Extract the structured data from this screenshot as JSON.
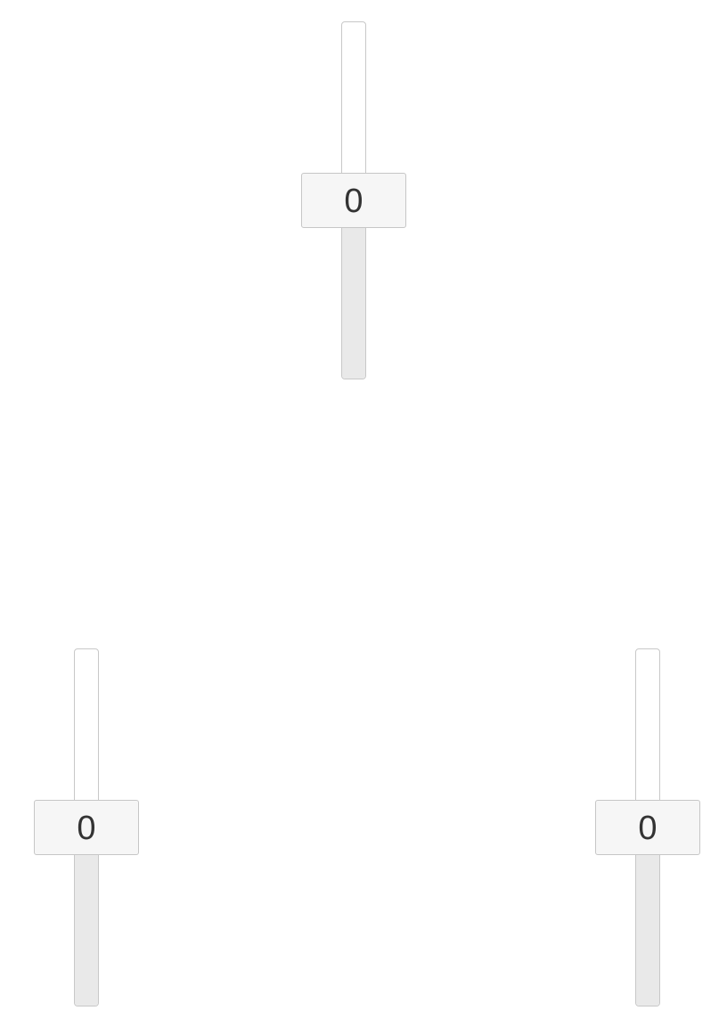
{
  "sliders": [
    {
      "id": "slider-top",
      "value": "0",
      "min": 0,
      "max": 100,
      "level": 0.5
    },
    {
      "id": "slider-bottom-left",
      "value": "0",
      "min": 0,
      "max": 100,
      "level": 0.5
    },
    {
      "id": "slider-bottom-right",
      "value": "0",
      "min": 0,
      "max": 100,
      "level": 0.5
    }
  ],
  "colors": {
    "track_empty": "#ffffff",
    "track_fill": "#e9e9e9",
    "handle_bg": "#f6f6f6",
    "border": "#c8c8c8",
    "text": "#333333"
  }
}
